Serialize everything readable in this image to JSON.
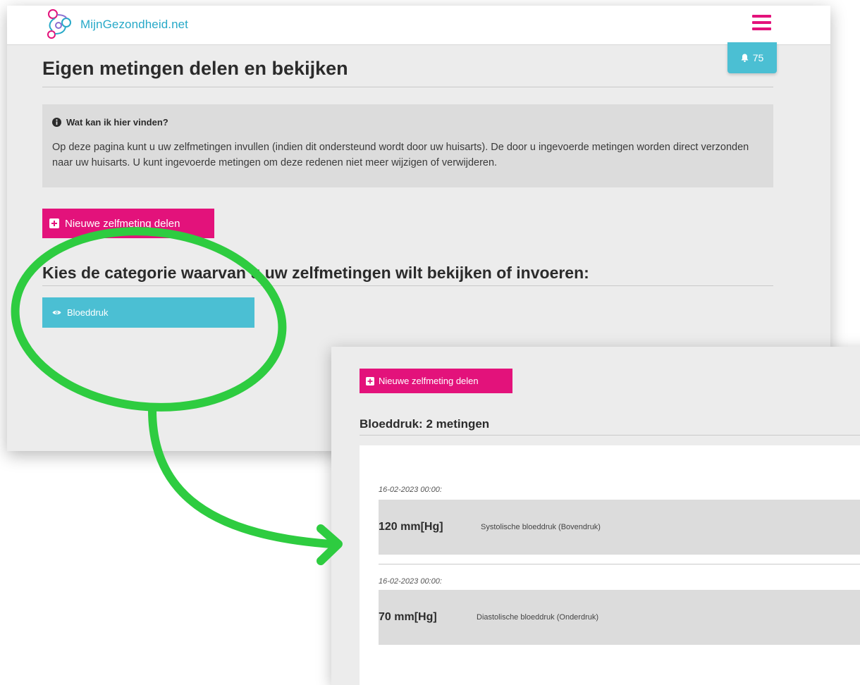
{
  "header": {
    "logo_text": "MijnGezondheid.net",
    "notifications_count": "75"
  },
  "page": {
    "title": "Eigen metingen delen en bekijken"
  },
  "info": {
    "heading": "Wat kan ik hier vinden?",
    "text": "Op deze pagina kunt u uw zelfmetingen invullen (indien dit ondersteund wordt door uw huisarts). De door u ingevoerde metingen worden direct verzonden naar uw huisarts. U kunt ingevoerde metingen om deze redenen niet meer wijzigen of verwijderen."
  },
  "actions": {
    "new_measurement_label": "Nieuwe zelfmeting delen"
  },
  "category": {
    "prompt": "Kies de categorie waarvan u uw zelfmetingen wilt bekijken of invoeren:",
    "items": [
      {
        "label": "Bloeddruk"
      }
    ]
  },
  "detail": {
    "new_measurement_label": "Nieuwe zelfmeting delen",
    "title": "Bloeddruk: 2 metingen",
    "measurements": [
      {
        "date": "16-02-2023 00:00:",
        "value": "120 mm[Hg]",
        "label": "Systolische bloeddruk (Bovendruk)"
      },
      {
        "date": "16-02-2023 00:00:",
        "value": "70 mm[Hg]",
        "label": "Diastolische bloeddruk (Onderdruk)"
      }
    ]
  },
  "colors": {
    "brand_pink": "#e3127b",
    "brand_cyan": "#4bbfd3",
    "annotation_green": "#2ecc40"
  },
  "icons": {
    "menu": "hamburger-menu-icon",
    "notifications": "bell-icon",
    "info": "info-circle-icon",
    "add": "plus-square-icon",
    "view": "eye-icon"
  }
}
